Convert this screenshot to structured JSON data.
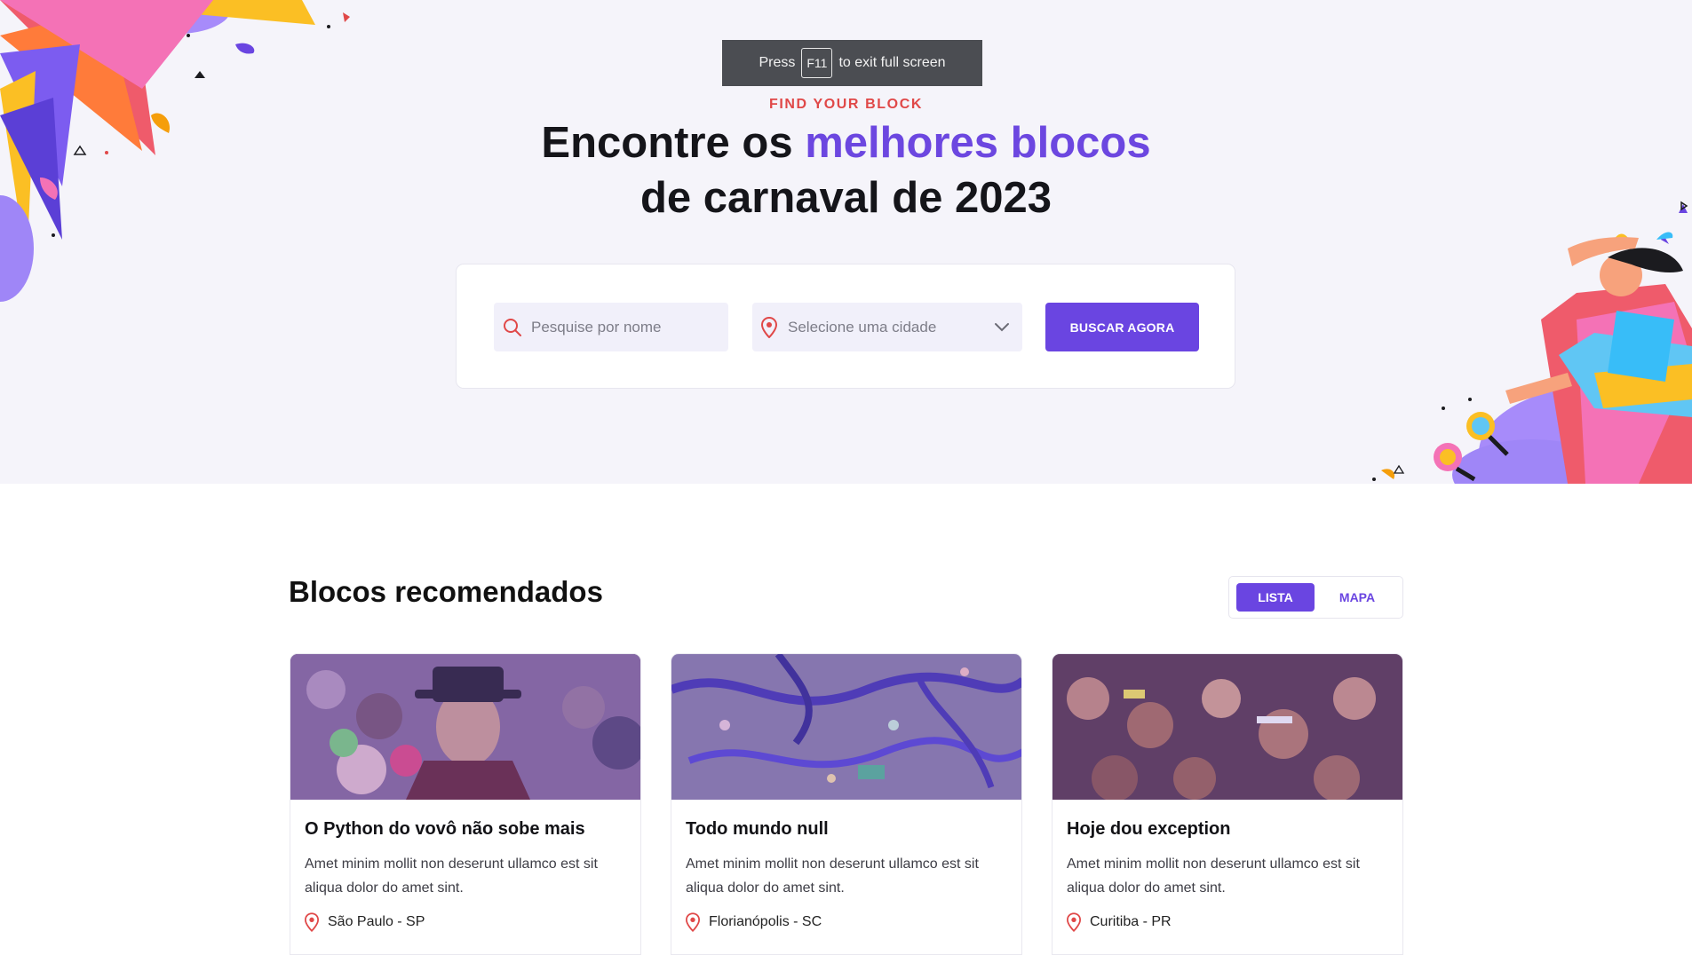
{
  "fullscreen_notice": {
    "press": "Press",
    "key": "F11",
    "suffix": "to exit full screen"
  },
  "hero": {
    "eyebrow": "FIND YOUR BLOCK",
    "headline_part1": "Encontre os ",
    "headline_accent": "melhores blocos",
    "headline_line2": "de carnaval de 2023"
  },
  "search": {
    "name_placeholder": "Pesquise por nome",
    "city_placeholder": "Selecione uma cidade",
    "button_label": "BUSCAR AGORA"
  },
  "recommended": {
    "title": "Blocos recomendados",
    "view_options": {
      "list": "LISTA",
      "map": "MAPA",
      "selected": "LISTA"
    }
  },
  "cards": [
    {
      "title": "O Python do vovô não sobe mais",
      "description": "Amet minim mollit non deserunt ullamco est sit aliqua dolor do amet sint.",
      "location": "São Paulo - SP"
    },
    {
      "title": "Todo mundo null",
      "description": "Amet minim mollit non deserunt ullamco est sit aliqua dolor do amet sint.",
      "location": "Florianópolis - SC"
    },
    {
      "title": "Hoje dou exception",
      "description": "Amet minim mollit non deserunt ullamco est sit aliqua dolor do amet sint.",
      "location": "Curitiba - PR"
    }
  ],
  "colors": {
    "primary": "#6a45e1",
    "accent_red": "#e04848",
    "hero_bg": "#f5f4fa"
  }
}
